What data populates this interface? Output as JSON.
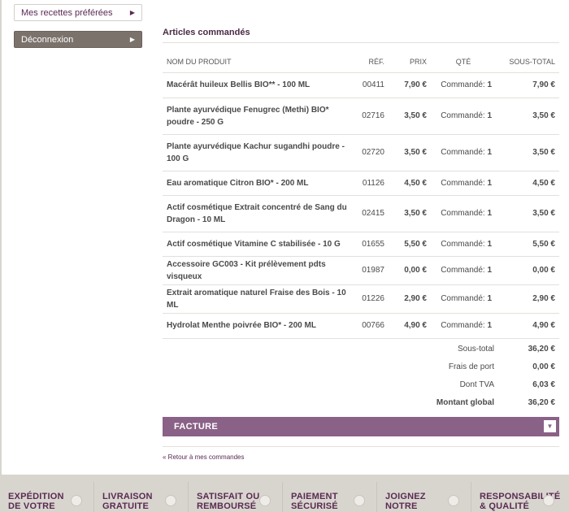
{
  "sidebar": {
    "recipes_label": "Mes recettes préférées",
    "logout_label": "Déconnexion"
  },
  "main": {
    "title": "Articles commandés",
    "columns": {
      "product": "NOM DU PRODUIT",
      "ref": "RÉF.",
      "price": "PRIX",
      "qty": "QTÉ",
      "subtotal": "SOUS-TOTAL"
    },
    "qty_prefix": "Commandé:",
    "rows": [
      {
        "name": "Macérât huileux Bellis BIO** - 100 ML",
        "ref": "00411",
        "price": "7,90 €",
        "qty": "1",
        "subtotal": "7,90 €"
      },
      {
        "name": "Plante ayurvédique Fenugrec (Methi) BIO* poudre - 250 G",
        "ref": "02716",
        "price": "3,50 €",
        "qty": "1",
        "subtotal": "3,50 €"
      },
      {
        "name": "Plante ayurvédique Kachur sugandhi poudre - 100 G",
        "ref": "02720",
        "price": "3,50 €",
        "qty": "1",
        "subtotal": "3,50 €"
      },
      {
        "name": "Eau aromatique Citron BIO* - 200 ML",
        "ref": "01126",
        "price": "4,50 €",
        "qty": "1",
        "subtotal": "4,50 €"
      },
      {
        "name": "Actif cosmétique Extrait concentré de Sang du Dragon - 10 ML",
        "ref": "02415",
        "price": "3,50 €",
        "qty": "1",
        "subtotal": "3,50 €"
      },
      {
        "name": "Actif cosmétique Vitamine C stabilisée - 10 G",
        "ref": "01655",
        "price": "5,50 €",
        "qty": "1",
        "subtotal": "5,50 €"
      },
      {
        "name": "Accessoire GC003 - Kit prélèvement pdts visqueux",
        "ref": "01987",
        "price": "0,00 €",
        "qty": "1",
        "subtotal": "0,00 €"
      },
      {
        "name": "Extrait aromatique naturel Fraise des Bois - 10 ML",
        "ref": "01226",
        "price": "2,90 €",
        "qty": "1",
        "subtotal": "2,90 €"
      },
      {
        "name": "Hydrolat Menthe poivrée BIO* - 200 ML",
        "ref": "00766",
        "price": "4,90 €",
        "qty": "1",
        "subtotal": "4,90 €"
      }
    ],
    "totals": {
      "subtotal_label": "Sous-total",
      "subtotal": "36,20 €",
      "shipping_label": "Frais de port",
      "shipping": "0,00 €",
      "tax_label": "Dont TVA",
      "tax": "6,03 €",
      "grand_label": "Montant global",
      "grand": "36,20 €"
    },
    "invoice_label": "FACTURE",
    "back_link": "« Retour à mes commandes"
  },
  "footer": {
    "items": [
      {
        "l1": "EXPÉDITION",
        "l2": "DE VOTRE"
      },
      {
        "l1": "LIVRAISON",
        "l2": "GRATUITE"
      },
      {
        "l1": "SATISFAIT OU",
        "l2": "REMBOURSÉ"
      },
      {
        "l1": "PAIEMENT",
        "l2": "SÉCURISÉ"
      },
      {
        "l1": "JOIGNEZ",
        "l2": "NOTRE"
      },
      {
        "l1": "RESPONSABILITÉ",
        "l2": "& QUALITÉ"
      }
    ]
  }
}
